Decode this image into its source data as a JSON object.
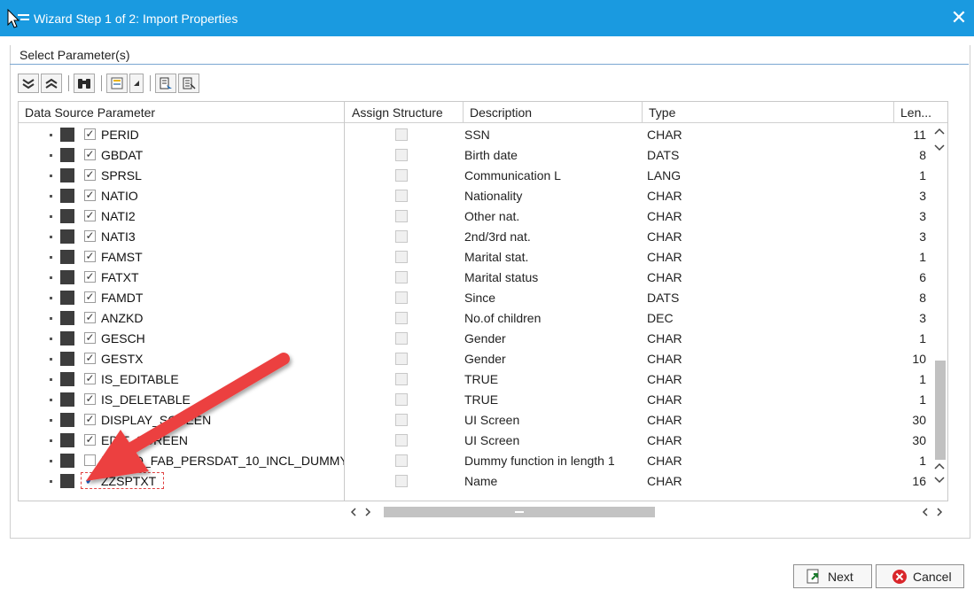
{
  "window": {
    "title": "Wizard Step 1 of 2: Import Properties",
    "close_glyph": "✕"
  },
  "group": {
    "label": "Select Parameter(s)"
  },
  "columns": {
    "param": "Data Source Parameter",
    "assign": "Assign Structure",
    "description": "Description",
    "type": "Type",
    "length": "Len..."
  },
  "rows": [
    {
      "param": "PERID",
      "checked": true,
      "description": "SSN",
      "type": "CHAR",
      "length": "11"
    },
    {
      "param": "GBDAT",
      "checked": true,
      "description": "Birth date",
      "type": "DATS",
      "length": "8"
    },
    {
      "param": "SPRSL",
      "checked": true,
      "description": "Communication L",
      "type": "LANG",
      "length": "1"
    },
    {
      "param": "NATIO",
      "checked": true,
      "description": "Nationality",
      "type": "CHAR",
      "length": "3"
    },
    {
      "param": "NATI2",
      "checked": true,
      "description": "Other nat.",
      "type": "CHAR",
      "length": "3"
    },
    {
      "param": "NATI3",
      "checked": true,
      "description": "2nd/3rd nat.",
      "type": "CHAR",
      "length": "3"
    },
    {
      "param": "FAMST",
      "checked": true,
      "description": "Marital stat.",
      "type": "CHAR",
      "length": "1"
    },
    {
      "param": "FATXT",
      "checked": true,
      "description": "Marital status",
      "type": "CHAR",
      "length": "6"
    },
    {
      "param": "FAMDT",
      "checked": true,
      "description": "Since",
      "type": "DATS",
      "length": "8"
    },
    {
      "param": "ANZKD",
      "checked": true,
      "description": "No.of children",
      "type": "DEC",
      "length": "3"
    },
    {
      "param": "GESCH",
      "checked": true,
      "description": "Gender",
      "type": "CHAR",
      "length": "1"
    },
    {
      "param": "GESTX",
      "checked": true,
      "description": "Gender",
      "type": "CHAR",
      "length": "10"
    },
    {
      "param": "IS_EDITABLE",
      "checked": true,
      "description": "TRUE",
      "type": "CHAR",
      "length": "1"
    },
    {
      "param": "IS_DELETABLE",
      "checked": true,
      "description": "TRUE",
      "type": "CHAR",
      "length": "1"
    },
    {
      "param": "DISPLAY_SCREEN",
      "checked": true,
      "description": "UI Screen",
      "type": "CHAR",
      "length": "30"
    },
    {
      "param": "EDIT_SCREEN",
      "checked": true,
      "description": "UI Screen",
      "type": "CHAR",
      "length": "30"
    },
    {
      "param": "HRPAD_FAB_PERSDAT_10_INCL_DUMMY",
      "checked": false,
      "description": "Dummy function in length 1",
      "type": "CHAR",
      "length": "1"
    },
    {
      "param": "ZZSPTXT",
      "checked": true,
      "description": "Name",
      "type": "CHAR",
      "length": "16"
    }
  ],
  "buttons": {
    "next": "Next",
    "cancel": "Cancel"
  },
  "colors": {
    "titlebar": "#1a9ae0",
    "arrow": "#e8403f",
    "highlight_border": "#e04040",
    "check_blue": "#1d5fb8"
  }
}
